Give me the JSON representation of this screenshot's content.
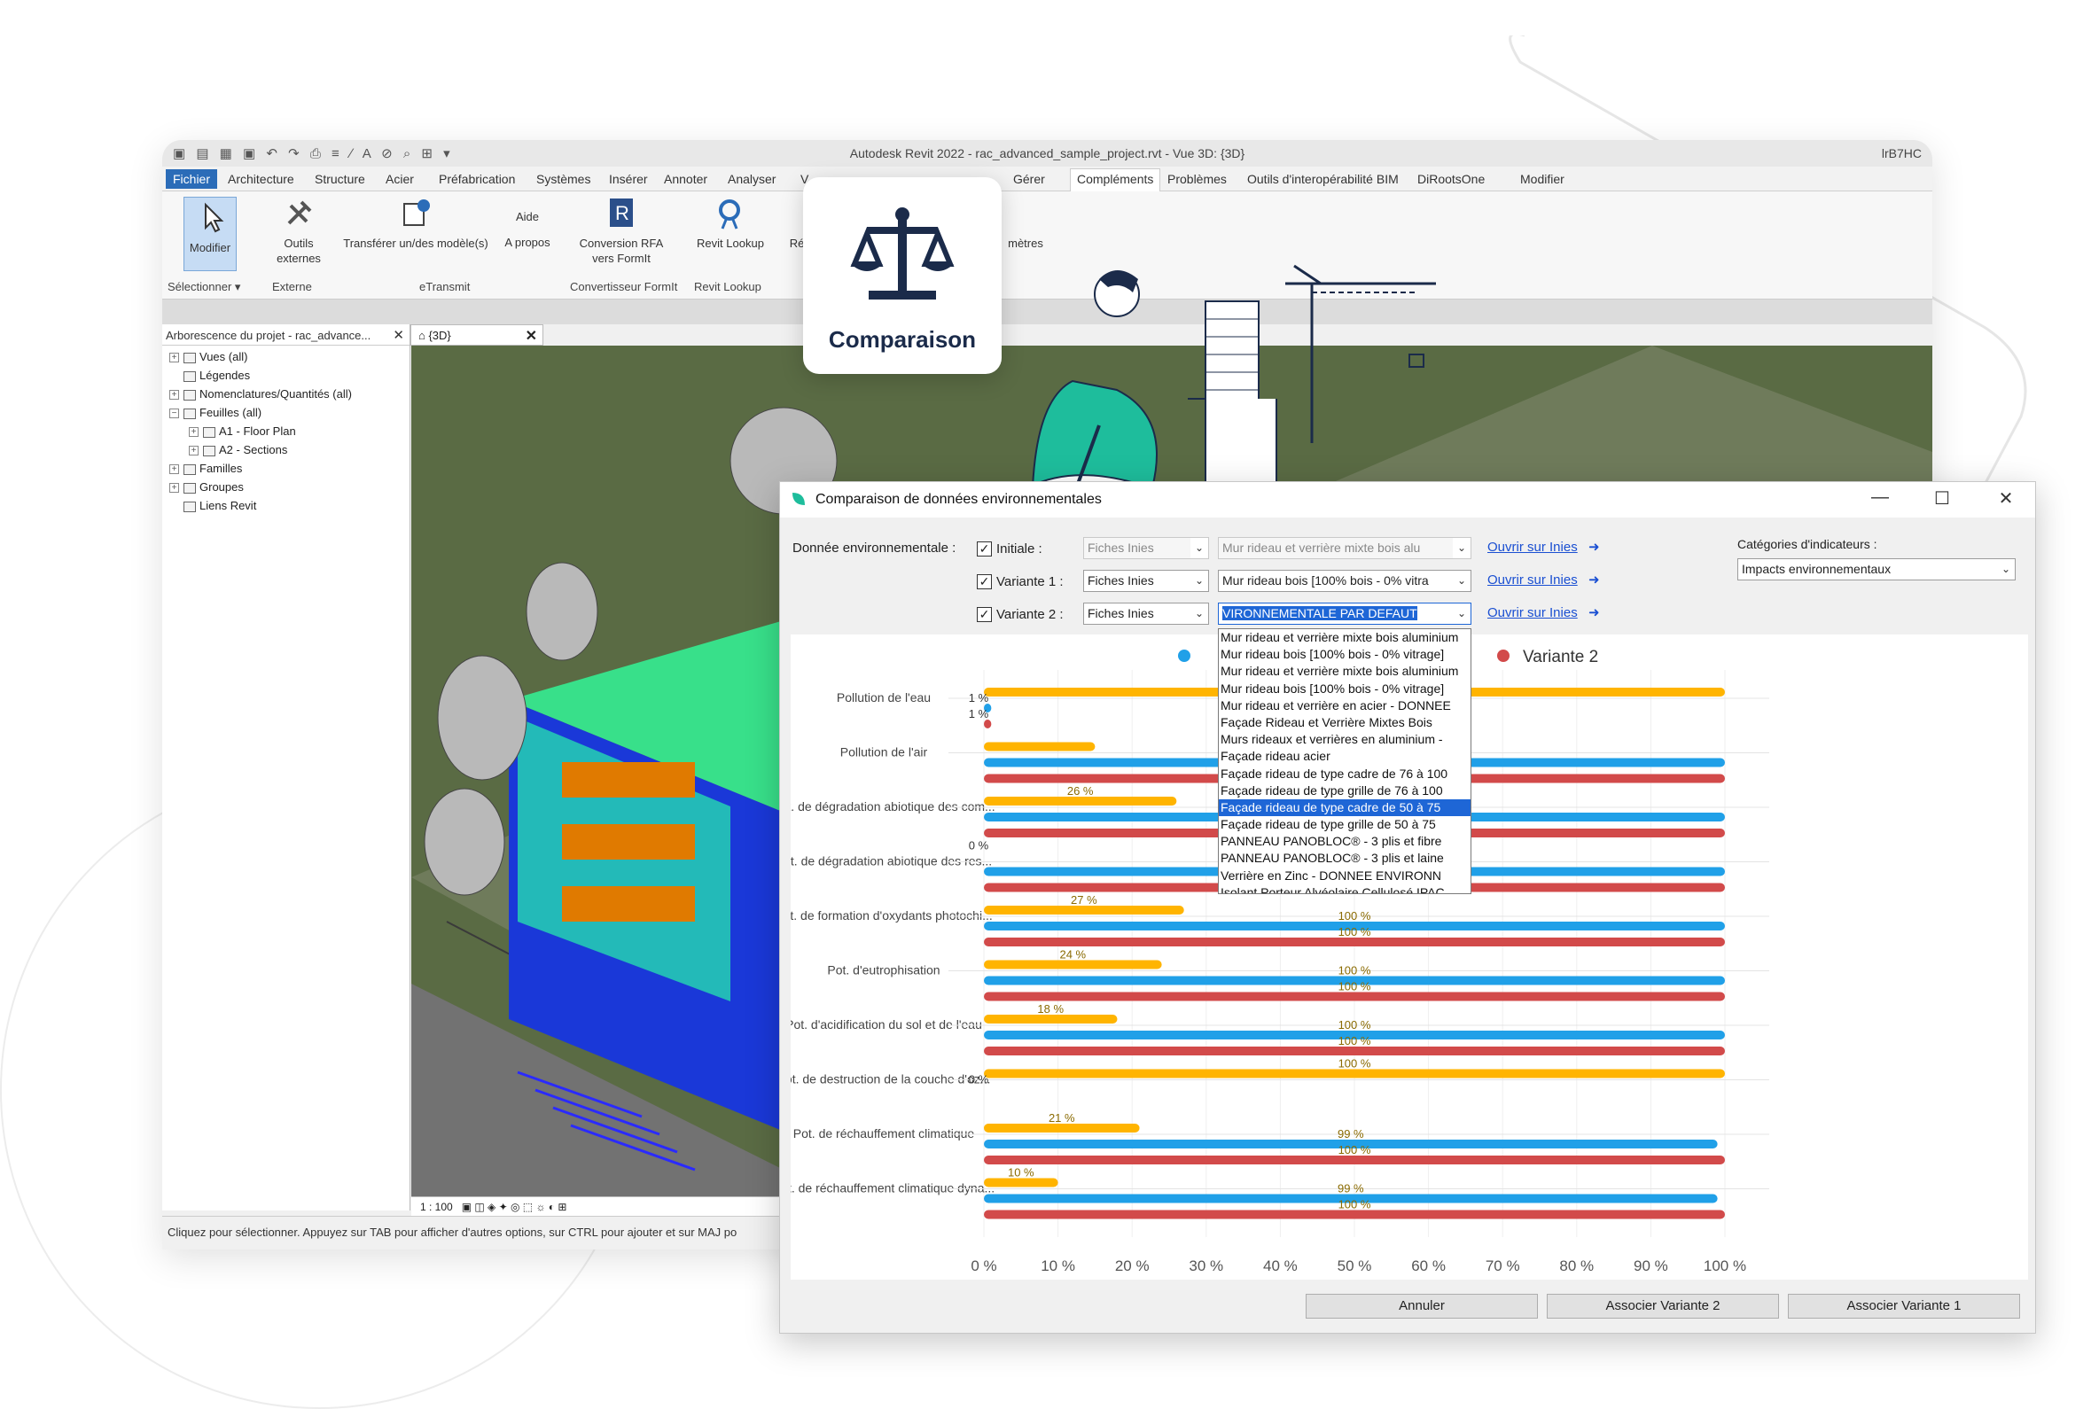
{
  "revit": {
    "title": "Autodesk Revit 2022 - rac_advanced_sample_project.rvt - Vue 3D: {3D}",
    "user": "lrB7HC",
    "tabs": [
      "Fichier",
      "Architecture",
      "Structure",
      "Acier",
      "Préfabrication",
      "Systèmes",
      "Insérer",
      "Annoter",
      "Analyser",
      "V",
      "Gérer",
      "Compléments",
      "Problèmes",
      "Outils d'interopérabilité BIM",
      "DiRootsOne",
      "Modifier"
    ],
    "ribbon": {
      "modifier": "Modifier",
      "outils_externes": "Outils externes",
      "transferer": "Transférer un/des modèle(s)",
      "aide": "Aide",
      "apropos": "A propos",
      "conversion": "Conversion RFA vers FormIt",
      "revit_lookup": "Revit Lookup",
      "re": "Ré",
      "metres": "mètres",
      "groups": {
        "selectionner": "Sélectionner",
        "externe": "Externe",
        "etransmit": "eTransmit",
        "convertisseur": "Convertisseur FormIt",
        "revit_lookup": "Revit Lookup"
      }
    },
    "browser": {
      "title": "Arborescence du projet - rac_advance...",
      "items": [
        "Vues (all)",
        "Légendes",
        "Nomenclatures/Quantités (all)",
        "Feuilles (all)",
        "A1 - Floor Plan",
        "A2 - Sections",
        "Familles",
        "Groupes",
        "Liens Revit"
      ]
    },
    "view_tab": "{3D}",
    "scale": "1 : 100",
    "status": "Cliquez pour sélectionner. Appuyez sur TAB pour afficher d'autres options, sur CTRL pour ajouter et sur MAJ po"
  },
  "badge": {
    "label": "Comparaison"
  },
  "dialog": {
    "title": "Comparaison de données environnementales",
    "donnee_label": "Donnée environnementale :",
    "rows": [
      {
        "label": "Initiale :",
        "source": "Fiches Inies",
        "product": "Mur rideau et verrière mixte bois alu",
        "link": "Ouvrir sur Inies"
      },
      {
        "label": "Variante 1 :",
        "source": "Fiches Inies",
        "product": "Mur rideau bois [100% bois - 0% vitra",
        "link": "Ouvrir sur Inies"
      },
      {
        "label": "Variante 2 :",
        "source": "Fiches Inies",
        "product": "VIRONNEMENTALE PAR DEFAUT",
        "link": "Ouvrir sur Inies"
      }
    ],
    "categories_label": "Catégories d'indicateurs :",
    "categories_value": "Impacts environnementaux",
    "dropdown_items": [
      "Mur rideau et verrière mixte bois aluminium",
      "Mur rideau bois [100% bois - 0% vitrage]",
      "Mur rideau et verrière mixte bois aluminium",
      "Mur rideau bois [100% bois - 0% vitrage]",
      "Mur rideau et verrière en acier - DONNEE",
      "Façade Rideau et Verrière Mixtes Bois",
      "Murs rideaux et verrières en aluminium -",
      "Façade rideau acier",
      "Façade rideau de type cadre de 76 à 100",
      "Façade rideau de type grille de 76 à 100",
      "Façade rideau de type cadre de 50 à 75",
      "Façade rideau de type grille de 50 à 75",
      "PANNEAU PANOBLOC® - 3 plis et fibre",
      "PANNEAU PANOBLOC® - 3 plis et laine",
      "Verrière en Zinc - DONNEE ENVIRONN",
      "Isolant Porteur Alvéolaire Cellulosé IPAC"
    ],
    "dropdown_highlight": 10,
    "buttons": {
      "annuler": "Annuler",
      "v2": "Associer Variante 2",
      "v1": "Associer Variante 1"
    }
  },
  "colors": {
    "initiale": "#ffb400",
    "variante1": "#20a0e8",
    "variante2": "#d24a4a",
    "teal": "#1ebd9c",
    "navy": "#1b2b4a"
  },
  "chart_data": {
    "type": "bar",
    "orientation": "horizontal",
    "xlim": [
      0,
      100
    ],
    "x_ticks": [
      "0 %",
      "10 %",
      "20 %",
      "30 %",
      "40 %",
      "50 %",
      "60 %",
      "70 %",
      "80 %",
      "90 %",
      "100 %"
    ],
    "legend": {
      "placement": "top",
      "visible_names": [
        "",
        "Variante 2"
      ]
    },
    "categories": [
      "Pollution de l'eau",
      "Pollution de l'air",
      "Pot. de dégradation abiotique des com...",
      "Pot. de dégradation abiotique des res...",
      "Pot. de formation d'oxydants photochi...",
      "Pot. d'eutrophisation",
      "Pot. d'acidification du sol et de l'eau",
      "Pot. de destruction de la couche d'oz...",
      "Pot. de réchauffement climatique",
      "Pot. de réchauffement climatique dyna..."
    ],
    "series": [
      {
        "name": "",
        "color": "#ffb400",
        "values": [
          100,
          15,
          26,
          0,
          27,
          24,
          18,
          100,
          21,
          10
        ],
        "labels": [
          "100 %",
          "",
          "26 %",
          "0 %",
          "27 %",
          "24 %",
          "18 %",
          "100 %",
          "21 %",
          "10 %"
        ]
      },
      {
        "name": "",
        "color": "#20a0e8",
        "values": [
          1,
          100,
          100,
          100,
          100,
          100,
          100,
          0,
          99,
          99
        ],
        "labels": [
          "1 %",
          "100 %",
          "",
          "100 %",
          "100 %",
          "100 %",
          "100 %",
          "0 %",
          "99 %",
          "99 %"
        ]
      },
      {
        "name": "Variante 2",
        "color": "#d24a4a",
        "values": [
          1,
          100,
          100,
          100,
          100,
          100,
          100,
          0,
          100,
          100
        ],
        "labels": [
          "1 %",
          "100 %",
          "100 %",
          "100 %",
          "100 %",
          "100 %",
          "100 %",
          "",
          "100 %",
          "100 %"
        ]
      }
    ]
  }
}
